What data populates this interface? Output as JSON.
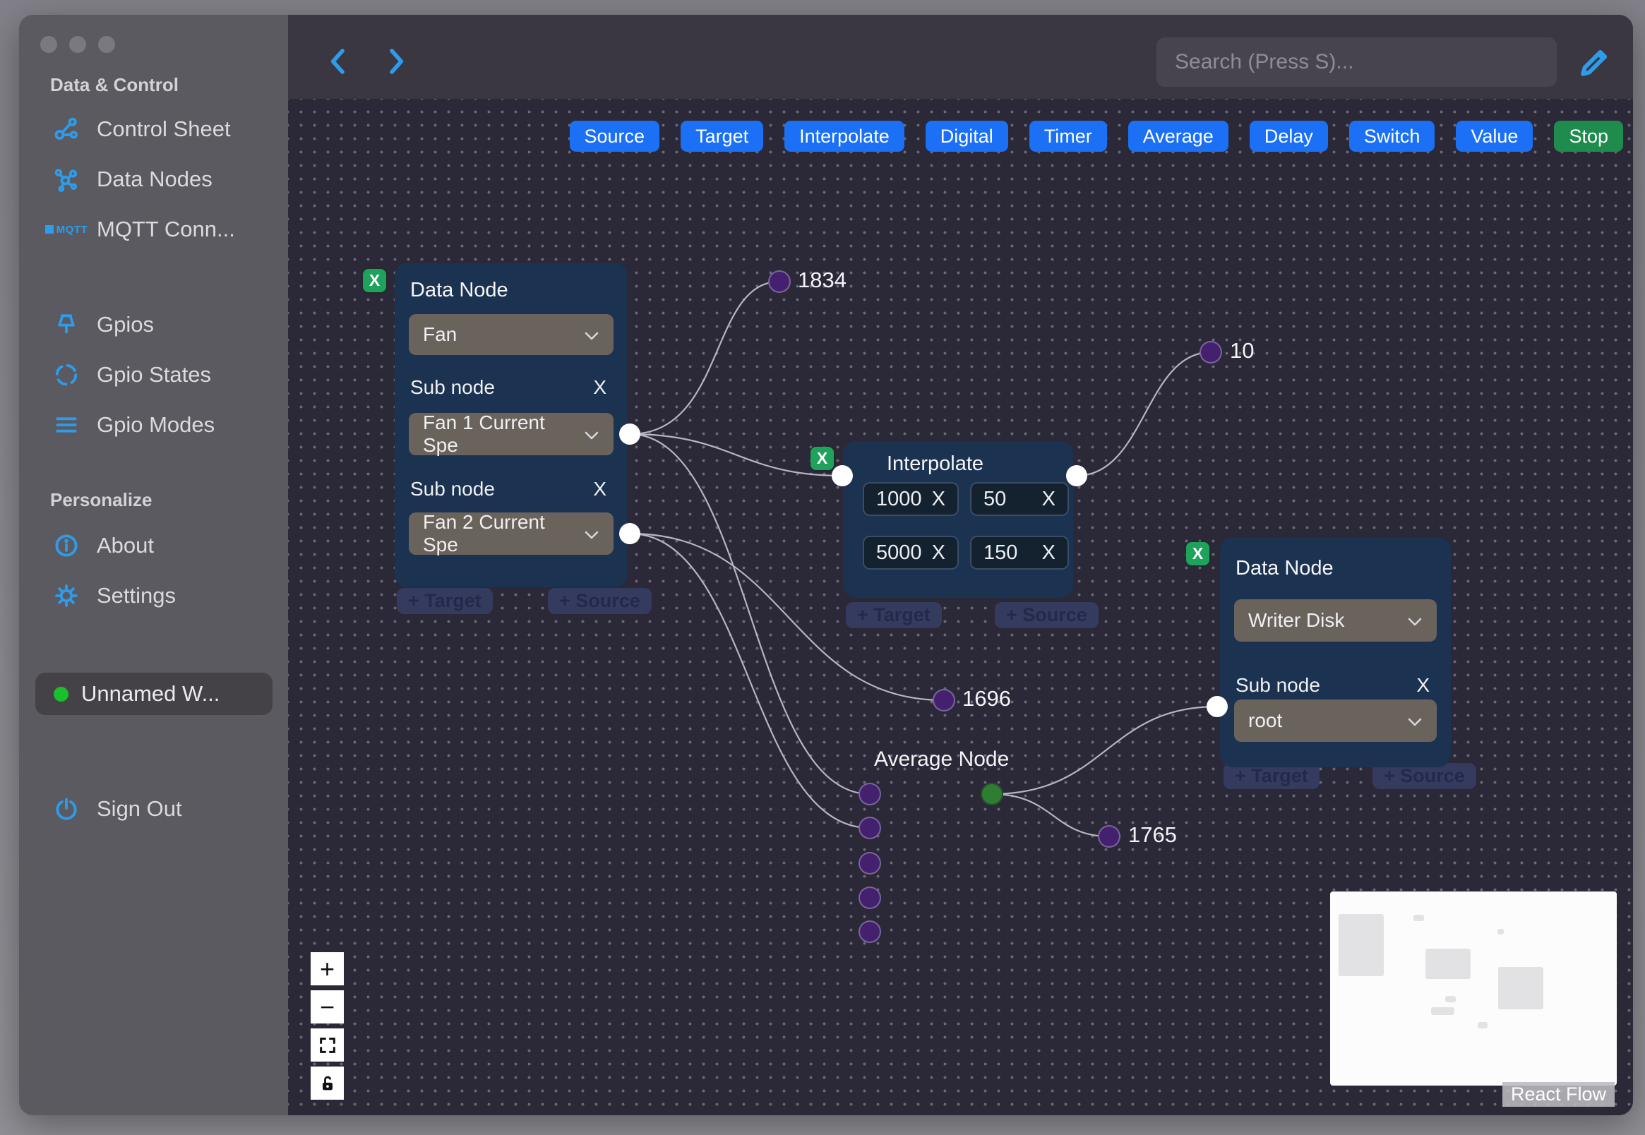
{
  "colors": {
    "accent_blue": "#2d9ceb",
    "toolbar_button_blue": "#1b70f5",
    "stop_green": "#1f8b4d",
    "delete_button_green": "#1fa25b",
    "node_card_blue": "#1b3251",
    "canvas_background": "#2b2837",
    "sidebar_background": "#5c5a61",
    "value_dot_purple": "#44216f",
    "average_dot_green": "#2e7d33",
    "workflow_status_green": "#18c02c"
  },
  "sidebar": {
    "section_data_control": "Data & Control",
    "items": [
      {
        "label": "Control Sheet",
        "icon": "network-icon"
      },
      {
        "label": "Data Nodes",
        "icon": "molecule-icon"
      },
      {
        "label": "MQTT Conn...",
        "icon": "mqtt-icon",
        "icon_text": "MQTT"
      },
      {
        "label": "Gpios",
        "icon": "pin-icon"
      },
      {
        "label": "Gpio States",
        "icon": "dashed-circle-icon"
      },
      {
        "label": "Gpio Modes",
        "icon": "lines-icon"
      }
    ],
    "section_personalize": "Personalize",
    "personalize_items": [
      {
        "label": "About",
        "icon": "info-icon"
      },
      {
        "label": "Settings",
        "icon": "gear-icon"
      }
    ],
    "workflow_item": {
      "label": "Unnamed W...",
      "status": "online"
    },
    "sign_out": {
      "label": "Sign Out",
      "icon": "power-icon"
    }
  },
  "topbar": {
    "search_placeholder": "Search (Press S)..."
  },
  "toolbar": {
    "buttons": [
      "Source",
      "Target",
      "Interpolate",
      "Digital",
      "Timer",
      "Average",
      "Delay",
      "Switch",
      "Value",
      "Stop"
    ]
  },
  "nodes": {
    "fan": {
      "title": "Data Node",
      "delete_label": "X",
      "type_value": "Fan",
      "sub_nodes": [
        {
          "label": "Sub node",
          "remove_label": "X",
          "value": "Fan 1 Current Spe"
        },
        {
          "label": "Sub node",
          "remove_label": "X",
          "value": "Fan 2 Current Spe"
        }
      ],
      "target_badge": "+ Target",
      "source_badge": "+ Source"
    },
    "interpolate": {
      "title": "Interpolate",
      "delete_label": "X",
      "values": [
        {
          "value": "1000",
          "remove_label": "X"
        },
        {
          "value": "50",
          "remove_label": "X"
        },
        {
          "value": "5000",
          "remove_label": "X"
        },
        {
          "value": "150",
          "remove_label": "X"
        }
      ],
      "target_badge": "+ Target",
      "source_badge": "+ Source"
    },
    "writer": {
      "title": "Data Node",
      "delete_label": "X",
      "type_value": "Writer Disk",
      "sub_nodes": [
        {
          "label": "Sub node",
          "remove_label": "X",
          "value": "root"
        }
      ],
      "target_badge": "+ Target",
      "source_badge": "+ Source"
    },
    "average": {
      "label": "Average Node"
    }
  },
  "edge_labels": {
    "v1834": "1834",
    "v10": "10",
    "v1696": "1696",
    "v1765": "1765"
  },
  "controls": {
    "zoom_in": "+",
    "zoom_out": "−"
  },
  "minimap": {
    "attribution": "React Flow"
  }
}
